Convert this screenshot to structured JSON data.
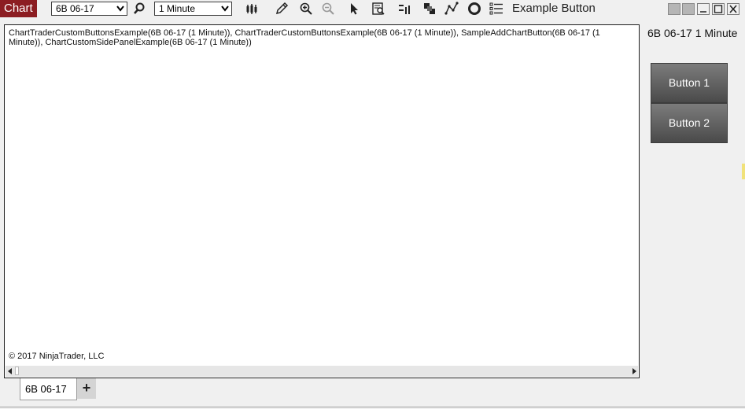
{
  "toolbar": {
    "title": "Chart",
    "instrument": "6B 06-17",
    "interval": "1 Minute",
    "example_button_label": "Example  Button"
  },
  "icons": {
    "search": "magnifier-icon",
    "bars": "bar-style-icon",
    "pencil": "drawing-tools-icon",
    "zoom_in": "zoom-in-icon",
    "zoom_out": "zoom-out-icon",
    "pointer": "cursor-pointer-icon",
    "data_box": "data-box-icon",
    "chart_trader": "chart-trader-icon",
    "order_depth": "order-depth-icon",
    "indicators": "indicators-icon",
    "strategies": "strategies-icon",
    "properties": "properties-icon"
  },
  "chart": {
    "indicator_label": "ChartTraderCustomButtonsExample(6B 06-17 (1 Minute)), ChartTraderCustomButtonsExample(6B 06-17 (1 Minute)), SampleAddChartButton(6B 06-17 (1 Minute)), ChartCustomSidePanelExample(6B 06-17 (1 Minute))",
    "copyright": "© 2017 NinjaTrader, LLC"
  },
  "side_panel": {
    "title": "6B 06-17 1 Minute",
    "button1": "Button 1",
    "button2": "Button 2"
  },
  "tabs": {
    "active_tab": "6B 06-17",
    "add_label": "+"
  },
  "colors": {
    "title_bg": "#8c1d22",
    "button_gradient_top": "#7c7c7c",
    "button_gradient_bottom": "#4a4a4a"
  }
}
